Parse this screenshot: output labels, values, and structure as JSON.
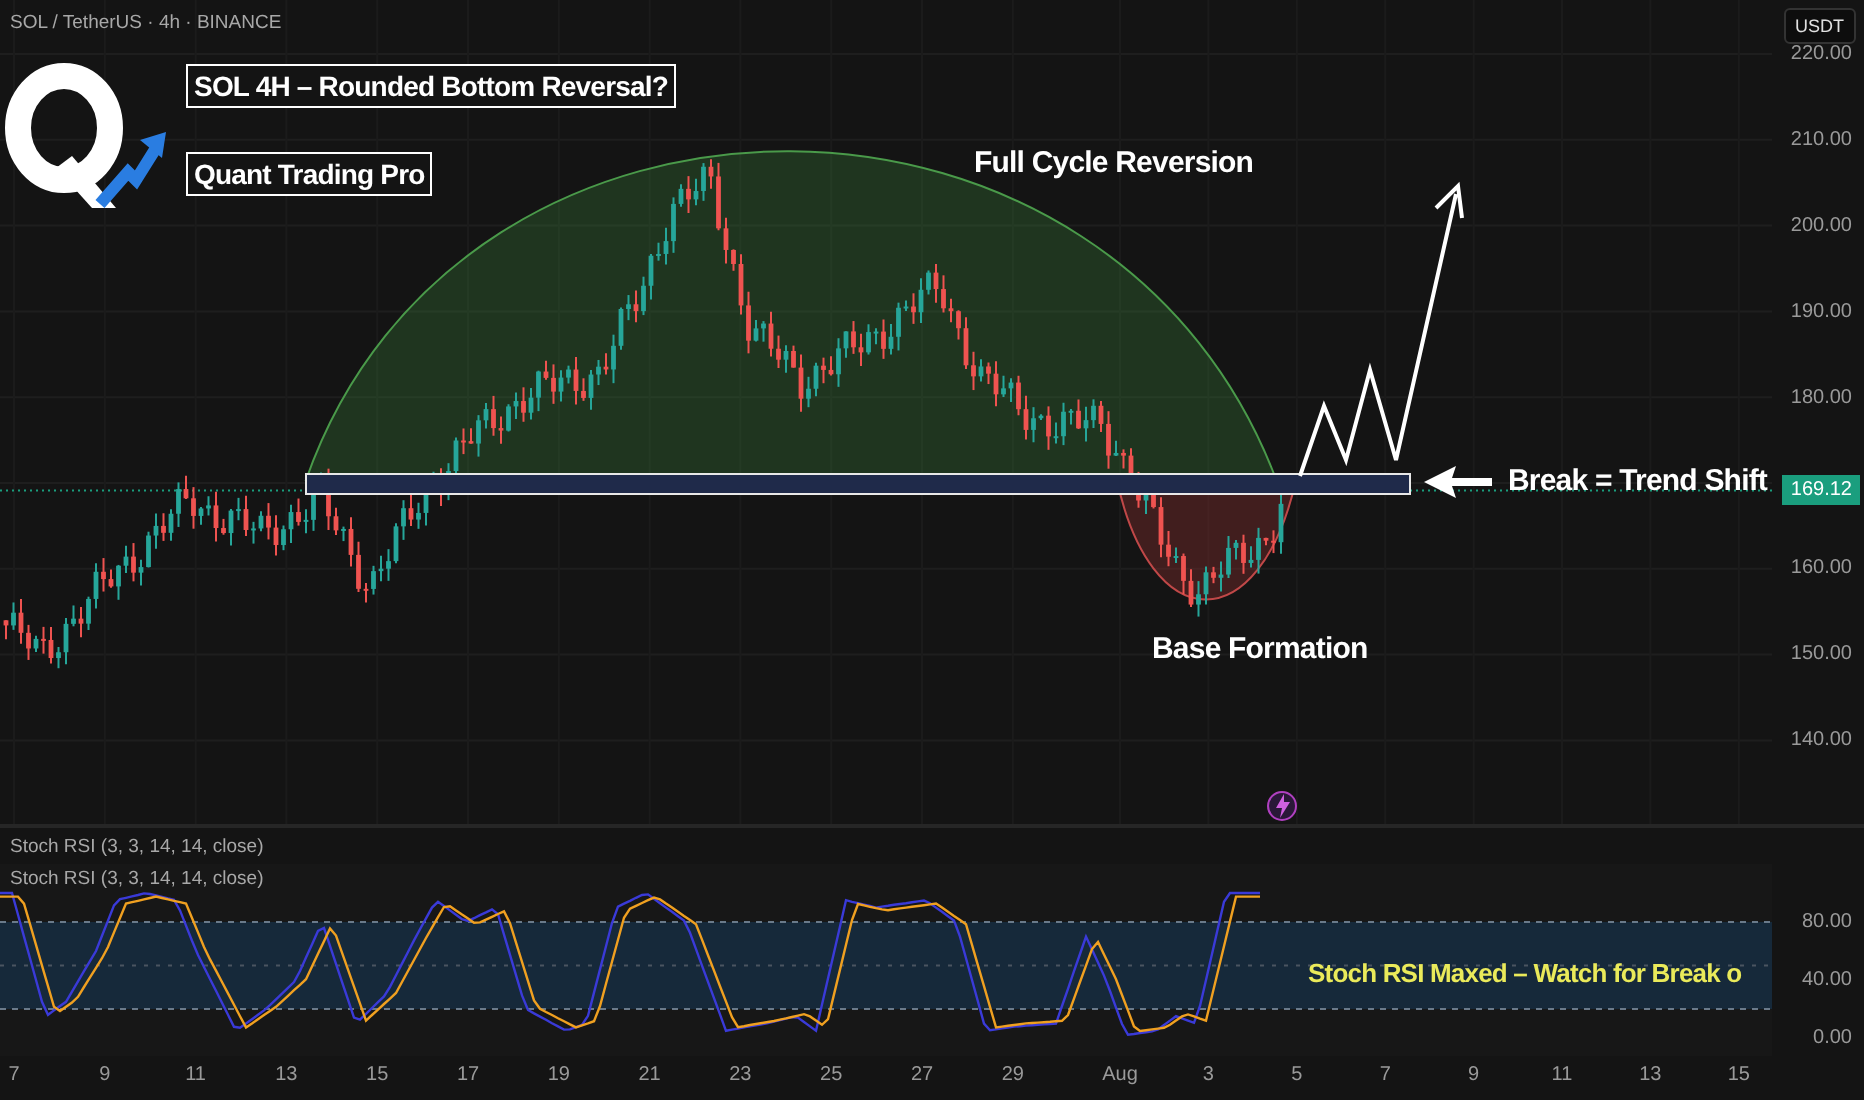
{
  "chart_header": {
    "symbol": "SOL / TetherUS · 4h · BINANCE",
    "currency_button": "USDT"
  },
  "annotations": {
    "title": "SOL 4H – Rounded Bottom Reversal?",
    "author": "Quant Trading Pro",
    "dome_label": "Full Cycle Reversion",
    "breakout_label": "Break = Trend Shift",
    "base_label": "Base Formation"
  },
  "price_axis": {
    "ticks": [
      "220.00",
      "210.00",
      "200.00",
      "190.00",
      "180.00",
      "160.00",
      "150.00",
      "140.00"
    ],
    "last_price": "169.12"
  },
  "indicator": {
    "header": "Stoch RSI (3, 3, 14, 14, close)",
    "legend": "Stoch RSI (3, 3, 14, 14, close)",
    "axis_ticks": [
      "80.00",
      "40.00",
      "0.00"
    ],
    "note": "Stoch RSI Maxed – Watch for Break o"
  },
  "time_axis": {
    "ticks": [
      "7",
      "9",
      "11",
      "13",
      "15",
      "17",
      "19",
      "21",
      "23",
      "25",
      "27",
      "29",
      "Aug",
      "3",
      "5",
      "7",
      "9",
      "11",
      "13",
      "15"
    ]
  }
}
